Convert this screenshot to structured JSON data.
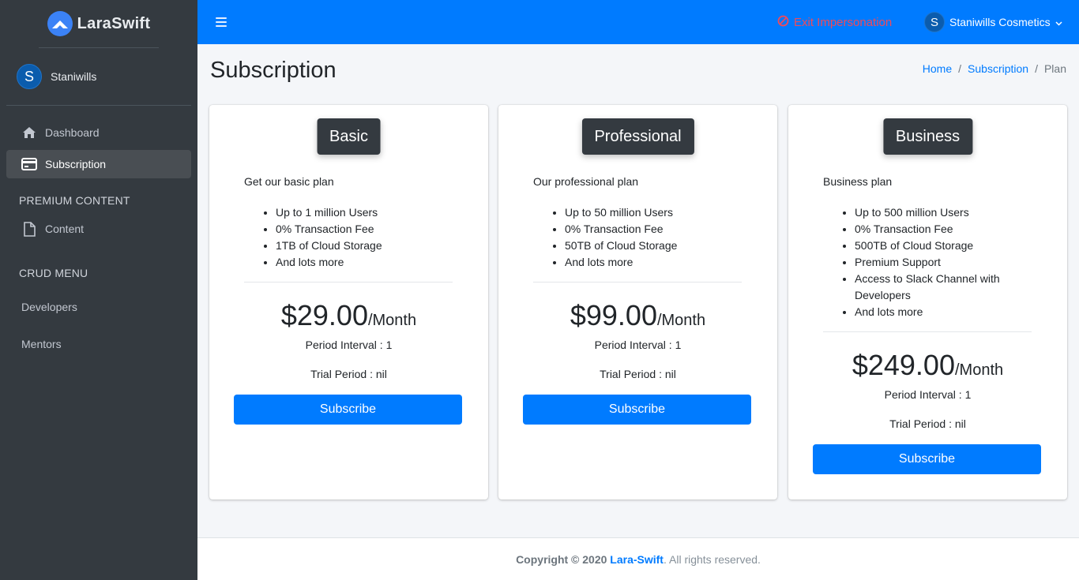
{
  "brand": {
    "name": "LaraSwift"
  },
  "user_panel": {
    "initial": "S",
    "name": "Staniwills"
  },
  "nav": {
    "dashboard": "Dashboard",
    "subscription": "Subscription",
    "premium_header": "PREMIUM CONTENT",
    "content": "Content",
    "crud_header": "CRUD MENU",
    "developers": "Developers",
    "mentors": "Mentors"
  },
  "topbar": {
    "exit_impersonation": "Exit Impersonation",
    "user_initial": "S",
    "user_name": "Staniwills Cosmetics"
  },
  "page": {
    "title": "Subscription",
    "breadcrumb": [
      "Home",
      "Subscription",
      "Plan"
    ]
  },
  "plans": [
    {
      "name": "Basic",
      "description": "Get our basic plan",
      "features": [
        "Up to 1 million Users",
        "0% Transaction Fee",
        "1TB of Cloud Storage",
        "And lots more"
      ],
      "price": "$29.00",
      "period_unit": "/Month",
      "interval": "Period Interval : 1",
      "trial": "Trial Period : nil",
      "button": "Subscribe"
    },
    {
      "name": "Professional",
      "description": "Our professional plan",
      "features": [
        "Up to 50 million Users",
        "0% Transaction Fee",
        "50TB of Cloud Storage",
        "And lots more"
      ],
      "price": "$99.00",
      "period_unit": "/Month",
      "interval": "Period Interval : 1",
      "trial": "Trial Period : nil",
      "button": "Subscribe"
    },
    {
      "name": "Business",
      "description": "Business plan",
      "features": [
        "Up to 500 million Users",
        "0% Transaction Fee",
        "500TB of Cloud Storage",
        "Premium Support",
        "Access to Slack Channel with Developers",
        "And lots more"
      ],
      "price": "$249.00",
      "period_unit": "/Month",
      "interval": "Period Interval : 1",
      "trial": "Trial Period : nil",
      "button": "Subscribe"
    }
  ],
  "footer": {
    "copyright": "Copyright © 2020",
    "brand": "Lara-Swift",
    "rights": ". All rights reserved."
  },
  "colors": {
    "primary": "#007bff",
    "sidebar": "#343a40",
    "danger": "#f04a5a"
  }
}
